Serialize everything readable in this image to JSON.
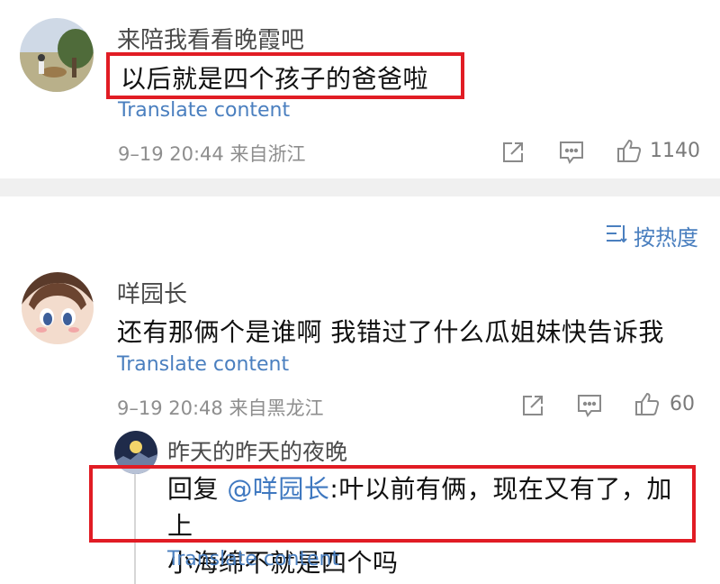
{
  "comment1": {
    "username": "来陪我看看晚霞吧",
    "content": "以后就是四个孩子的爸爸啦",
    "translate": "Translate content",
    "meta": "9–19 20:44 来自浙江",
    "likes": "1140"
  },
  "sort": {
    "label": "按热度"
  },
  "comment2": {
    "username": "咩园长",
    "content": "还有那俩个是谁啊 我错过了什么瓜姐妹快告诉我",
    "translate": "Translate content",
    "meta": "9–19 20:48 来自黑龙江",
    "likes": "60"
  },
  "reply": {
    "username": "昨天的昨天的夜晚",
    "prefix": "回复 ",
    "mention": "@咩园长",
    "text_line1": ":叶以前有俩，现在又有了，加上",
    "text_line2": "小海绵不就是四个吗",
    "translate": "Translate content"
  },
  "colors": {
    "accent": "#4a7fbf",
    "highlight": "#e11c24",
    "divider": "#f0f0f0"
  }
}
